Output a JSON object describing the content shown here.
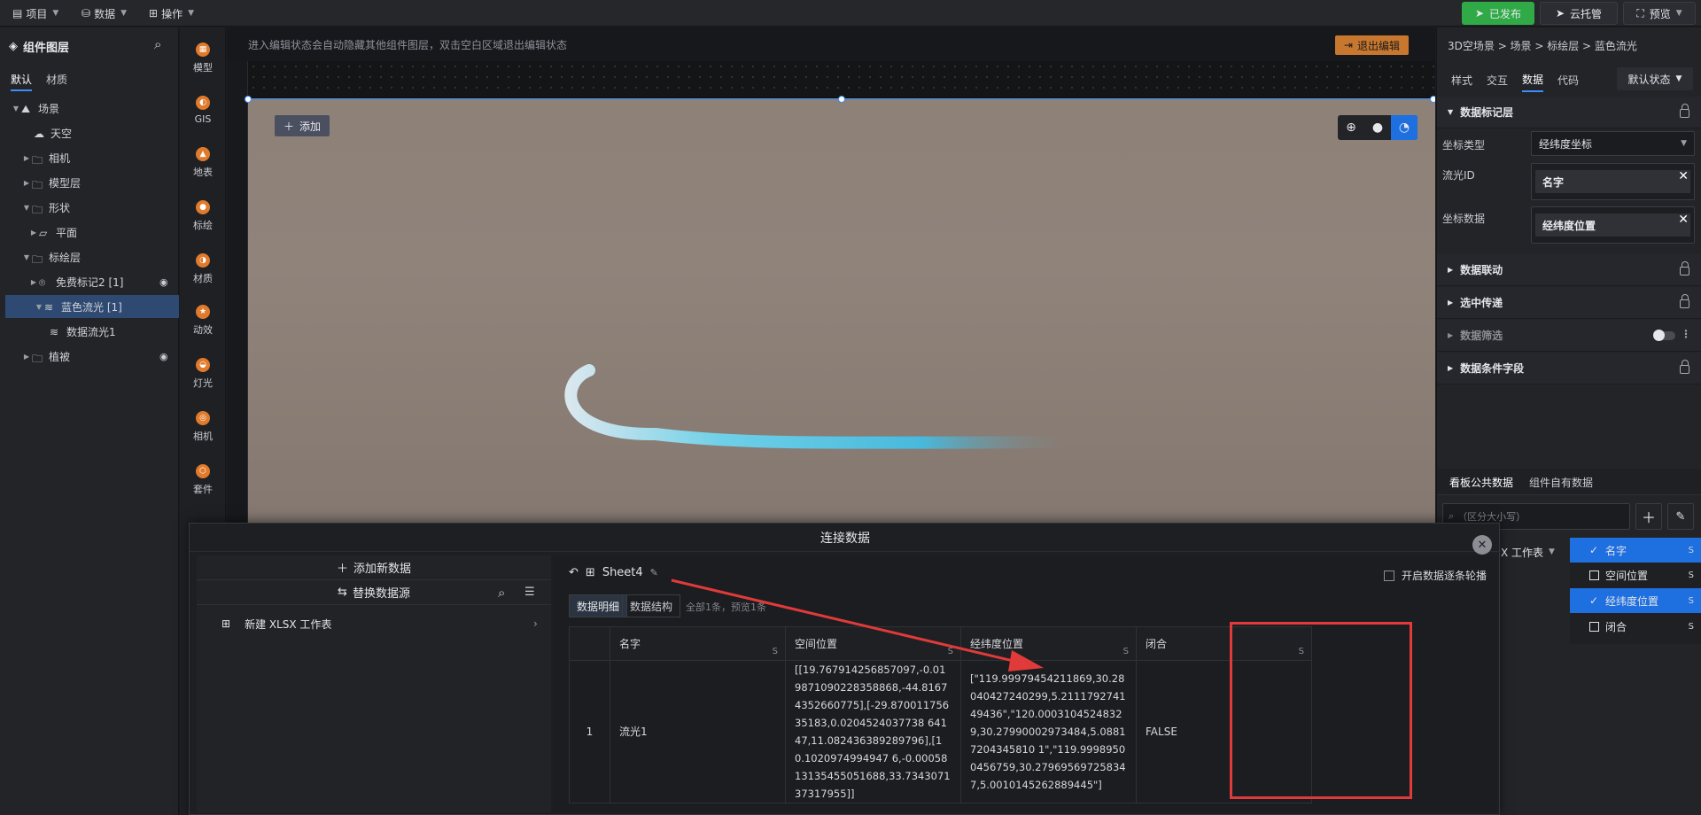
{
  "topbar": {
    "menus": [
      "项目",
      "数据",
      "操作"
    ],
    "publish": "已发布",
    "cloud": "云托管",
    "preview": "预览"
  },
  "layers": {
    "title": "组件图层",
    "tabs": [
      "默认",
      "材质"
    ],
    "tree": [
      {
        "label": "场景",
        "indent": 0
      },
      {
        "label": "天空",
        "indent": 1
      },
      {
        "label": "相机",
        "indent": 1
      },
      {
        "label": "模型层",
        "indent": 1
      },
      {
        "label": "形状",
        "indent": 1
      },
      {
        "label": "平面",
        "indent": 2
      },
      {
        "label": "标绘层",
        "indent": 1
      },
      {
        "label": "免费标记2 [1]",
        "indent": 2
      },
      {
        "label": "蓝色流光 [1]",
        "indent": 2
      },
      {
        "label": "数据流光1",
        "indent": 3
      },
      {
        "label": "植被",
        "indent": 1
      }
    ]
  },
  "tools": [
    "模型",
    "GIS",
    "地表",
    "标绘",
    "材质",
    "动效",
    "灯光",
    "相机",
    "套件"
  ],
  "canvas": {
    "hint": "进入编辑状态会自动隐藏其他组件图层，双击空白区域退出编辑状态",
    "exit": "退出编辑",
    "add": "添加"
  },
  "props": {
    "breadcrumb": "3D空场景 > 场景 > 标绘层 > 蓝色流光",
    "tabs": [
      "样式",
      "交互",
      "数据",
      "代码"
    ],
    "state": "默认状态",
    "section_main": "数据标记层",
    "coord_type_label": "坐标类型",
    "coord_type_value": "经纬度坐标",
    "flow_id_label": "流光ID",
    "flow_id_value": "名字",
    "coord_data_label": "坐标数据",
    "coord_data_value": "经纬度位置",
    "sections": [
      "数据联动",
      "选中传递",
      "数据筛选",
      "数据条件字段"
    ],
    "bottom_tabs": [
      "看板公共数据",
      "组件自有数据"
    ],
    "search_placeholder": "（区分大小写）",
    "sheet_partial": "X 工作表"
  },
  "modal": {
    "title": "连接数据",
    "add_new": "添加新数据",
    "replace": "替换数据源",
    "source": "新建 XLSX 工作表",
    "sheet": "Sheet4",
    "loop": "开启数据逐条轮播",
    "subtabs": [
      "数据明细",
      "数据结构"
    ],
    "summary": "全部1条，预览1条",
    "columns": [
      "名字",
      "空间位置",
      "经纬度位置",
      "闭合"
    ],
    "rows": [
      {
        "idx": "1",
        "name": "流光1",
        "space": "[[19.767914256857097,-0.019871090228358868,-44.81674352660775],[-29.87001175635183,0.0204524037738 64147,11.082436389289796],[10.1020974994947 6,-0.0005813135455051688,33.734307137317955]]",
        "geo": "[\"119.99979454211869,30.28040427240299,5.211179274149436\",\"120.00031045248329,30.27990002973484,5.08817204345810 1\",\"119.99989500456759,30.279695697258347,5.0010145262889445\"]",
        "closed": "FALSE"
      }
    ],
    "sz": "S"
  },
  "colList": [
    {
      "label": "名字",
      "on": true
    },
    {
      "label": "空间位置",
      "on": false
    },
    {
      "label": "经纬度位置",
      "on": true
    },
    {
      "label": "闭合",
      "on": false
    }
  ],
  "colors": {
    "accent": "#1e6fe0",
    "publish": "#2faa47",
    "exit": "#c8772f",
    "alert": "#e03a3a"
  }
}
